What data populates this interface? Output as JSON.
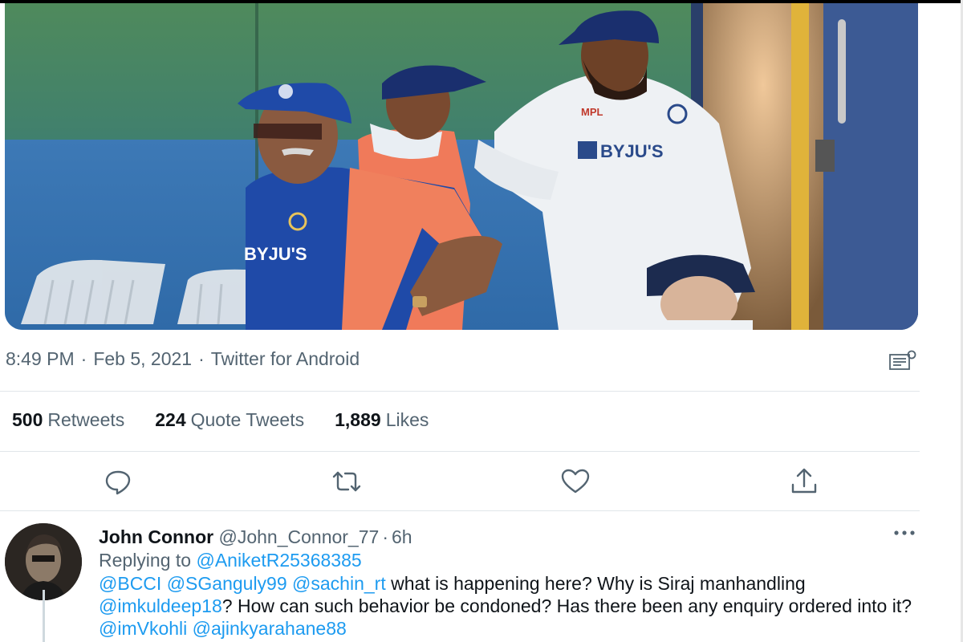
{
  "tweet": {
    "time": "8:49 PM",
    "date": "Feb 5, 2021",
    "source": "Twitter for Android",
    "media_texts": {
      "jersey_sponsor_left": "BYJU'S",
      "jersey_sponsor_right": "BYJU'S",
      "jersey_chest_logo": "MPL"
    }
  },
  "stats": {
    "retweets_count": "500",
    "retweets_label": "Retweets",
    "quotes_count": "224",
    "quotes_label": "Quote Tweets",
    "likes_count": "1,889",
    "likes_label": "Likes"
  },
  "actions": {
    "icons": [
      "reply-icon",
      "retweet-icon",
      "like-icon",
      "share-icon"
    ]
  },
  "reply": {
    "author_name": "John Connor",
    "handle": "@John_Connor_77",
    "separator": "·",
    "age": "6h",
    "replying_prefix": "Replying to",
    "replying_to": "@AniketR25368385",
    "mention_bcci": "@BCCI",
    "mention_sganguly": "@SGanguly99",
    "mention_sachin": "@sachin_rt",
    "text_1": "what is happening here? Why is Siraj manhandling",
    "mention_kuldeep": "@imkuldeep18",
    "text_2": "? How can such behavior be condoned? Has there been any enquiry ordered into it?",
    "mention_kohli": "@imVkohli",
    "mention_rahane": "@ajinkyarahane88"
  },
  "colors": {
    "link": "#1d9bf0",
    "secondary_text": "#536471",
    "primary_text": "#0f1419",
    "divider": "#e1e6ea"
  }
}
